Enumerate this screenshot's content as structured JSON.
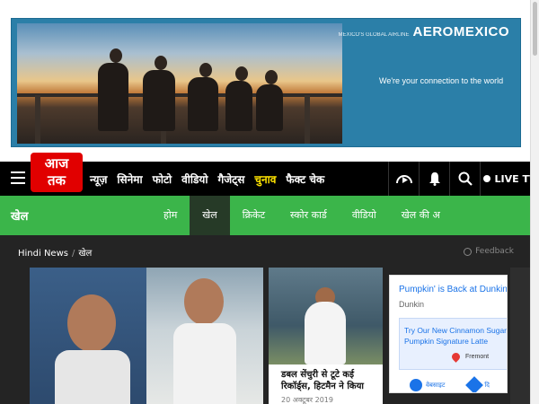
{
  "ad_banner": {
    "brand": "AEROMEXICO",
    "brand_small": "MEXICO'S GLOBAL AIRLINE",
    "tagline": "We're your connection to the world"
  },
  "header": {
    "logo_text_line1": "आज",
    "logo_text_line2": "तक",
    "nav_items": [
      "न्यूज़",
      "सिनेमा",
      "फोटो",
      "वीडियो",
      "गैजेट्स",
      "चुनाव",
      "फैक्ट चेक"
    ],
    "live_tv_label": "LIVE TV"
  },
  "sport_section": {
    "title": "खेल",
    "tabs": [
      "होम",
      "खेल",
      "क्रिकेट",
      "स्कोर कार्ड",
      "वीडियो",
      "खेल की अ"
    ],
    "active_tab": "खेल"
  },
  "breadcrumb": {
    "home": "Hindi News",
    "separator": "/",
    "current": "खेल"
  },
  "feedback_label": "Feedback",
  "news_card": {
    "title": "डबल सेंचुरी से टूटे कई रिकॉर्ड्स, हिटमैन ने किया",
    "date": "20 अक्टूबर 2019"
  },
  "side_ad": {
    "headline": "Pumpkin' is Back at Dunkin",
    "brand": "Dunkin",
    "promo_line1": "Try Our New Cinnamon Sugar",
    "promo_line2": "Pumpkin Signature Latte",
    "city": "Fremont",
    "btn1": "वेबसाइट",
    "btn2": "दि"
  },
  "colors": {
    "nav_bg": "#000000",
    "logo_red": "#e10000",
    "sport_green": "#3bb54a",
    "highlight_yellow": "#ffe400",
    "content_bg": "#242424"
  }
}
